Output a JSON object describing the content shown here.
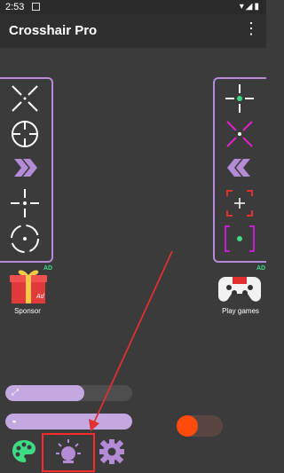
{
  "status_bar": {
    "time": "2:53"
  },
  "app_bar": {
    "title": "Crosshair Pro",
    "menu_icon": "more-vert-icon"
  },
  "left_panel": {
    "items": [
      "x-crosshair",
      "scope-crosshair",
      "chevron-right-crosshair",
      "dot-crosshair",
      "circle-crosshair"
    ]
  },
  "right_panel": {
    "items": [
      "green-dot-crosshair",
      "magenta-x-crosshair",
      "chevron-left-crosshair",
      "red-bracket-crosshair",
      "green-bracket-crosshair"
    ]
  },
  "sponsor": {
    "label": "Sponsor",
    "badge": "AD"
  },
  "play_games": {
    "label": "Play games",
    "badge": "AD"
  },
  "sliders": {
    "size_level": 0.62,
    "opacity_level": 1.0
  },
  "toggle": {
    "on": false,
    "color": "#ff4c0c"
  },
  "bottom_tabs": [
    "palette-icon",
    "bulb-icon",
    "settings-icon"
  ],
  "colors": {
    "accent": "#b48bd6",
    "highlight": "#ff2a2a",
    "green": "#3ddc84"
  }
}
